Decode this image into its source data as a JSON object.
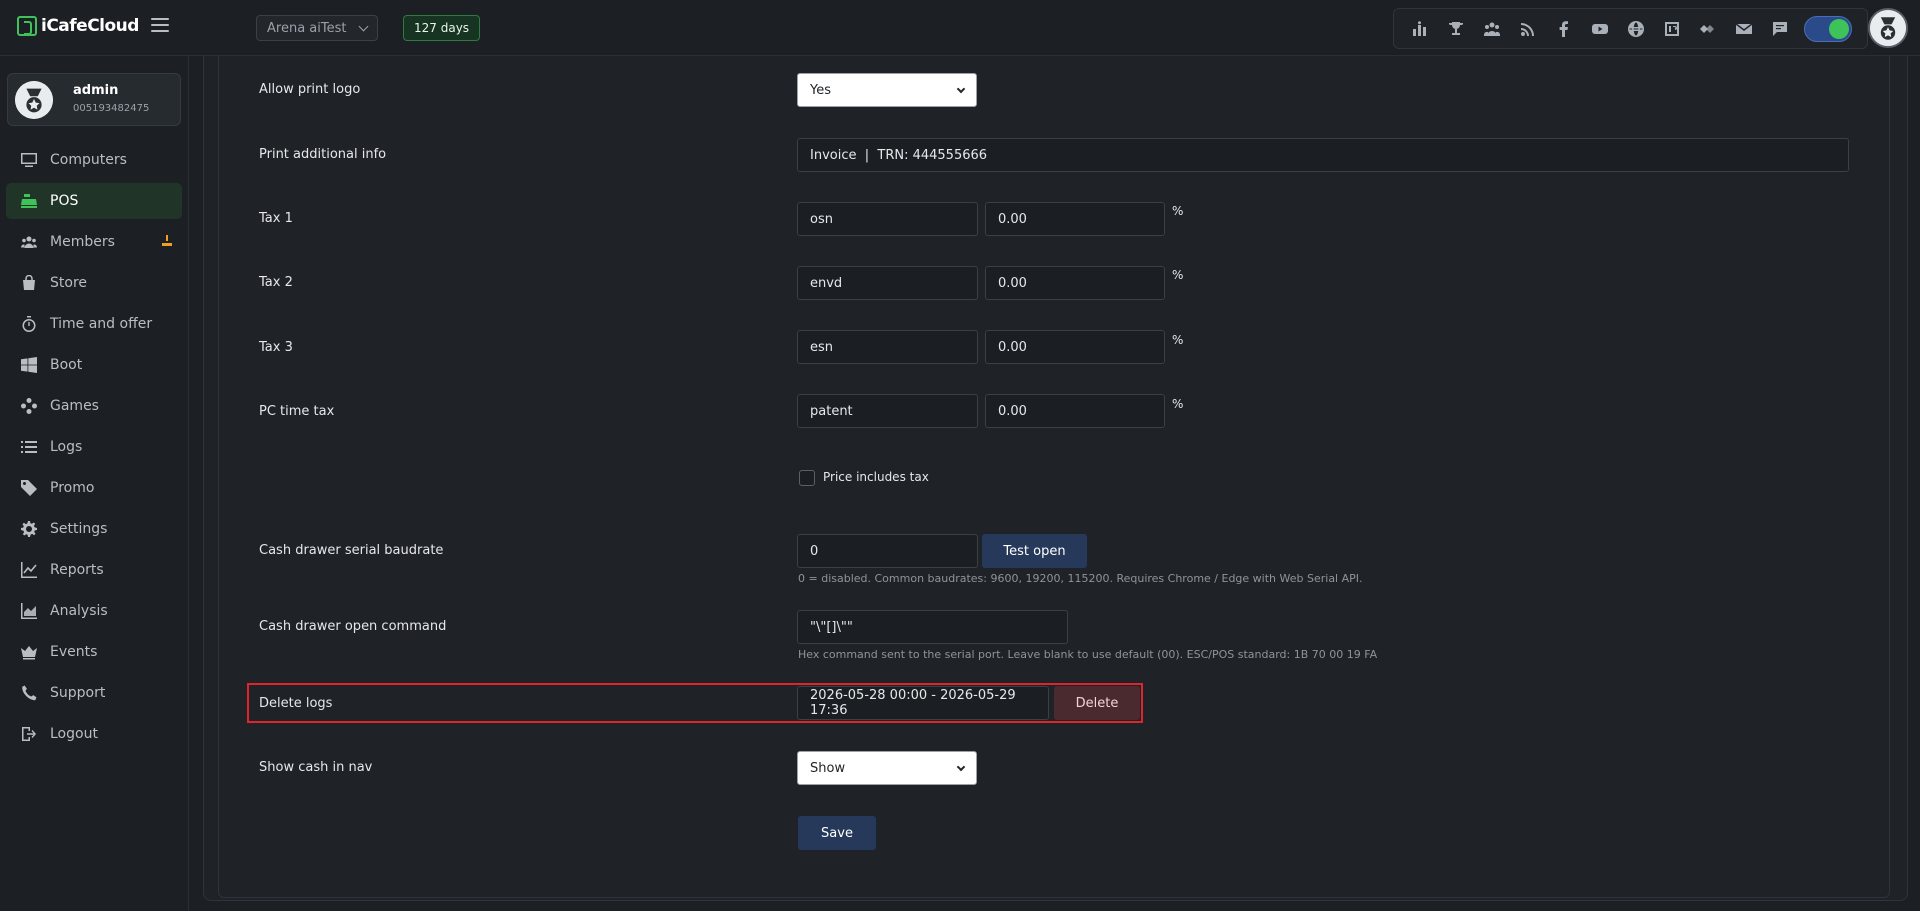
{
  "header": {
    "logo_text": "iCafeCloud",
    "cafe_name": "Arena aiTest",
    "days_badge": "127 days",
    "toolbar_icons": [
      "ranking-icon",
      "trophy-icon",
      "users-group-icon",
      "rss-icon",
      "facebook-icon",
      "youtube-icon",
      "globe-icon",
      "icafe-icon",
      "eye-icon",
      "mail-icon",
      "chat-icon"
    ]
  },
  "user": {
    "name": "admin",
    "id": "005193482475"
  },
  "sidebar": {
    "items": [
      {
        "label": "Computers",
        "icon": "monitor-icon"
      },
      {
        "label": "POS",
        "icon": "cash-register-icon"
      },
      {
        "label": "Members",
        "icon": "members-icon"
      },
      {
        "label": "Store",
        "icon": "bag-icon"
      },
      {
        "label": "Time and offer",
        "icon": "stopwatch-icon"
      },
      {
        "label": "Boot",
        "icon": "windows-icon"
      },
      {
        "label": "Games",
        "icon": "gamepad-icon"
      },
      {
        "label": "Logs",
        "icon": "list-icon"
      },
      {
        "label": "Promo",
        "icon": "tag-icon"
      },
      {
        "label": "Settings",
        "icon": "gear-icon"
      },
      {
        "label": "Reports",
        "icon": "chart-line-icon"
      },
      {
        "label": "Analysis",
        "icon": "chart-area-icon"
      },
      {
        "label": "Events",
        "icon": "crown-icon"
      },
      {
        "label": "Support",
        "icon": "phone-icon"
      },
      {
        "label": "Logout",
        "icon": "logout-icon"
      }
    ],
    "active": "POS",
    "accent": "#3ec35a"
  },
  "form": {
    "allow_print_logo": {
      "label": "Allow print logo",
      "value": "Yes"
    },
    "print_additional_info": {
      "label": "Print additional info",
      "value": "Invoice  |  TRN: 444555666"
    },
    "tax1": {
      "label": "Tax 1",
      "name": "osn",
      "rate": "0.00",
      "unit": "%"
    },
    "tax2": {
      "label": "Tax 2",
      "name": "envd",
      "rate": "0.00",
      "unit": "%"
    },
    "tax3": {
      "label": "Tax 3",
      "name": "esn",
      "rate": "0.00",
      "unit": "%"
    },
    "pc_time_tax": {
      "label": "PC time tax",
      "name": "patent",
      "rate": "0.00",
      "unit": "%"
    },
    "price_includes_tax": {
      "label": "Price includes tax",
      "checked": false
    },
    "cash_drawer_baudrate": {
      "label": "Cash drawer serial baudrate",
      "value": "0",
      "button": "Test open",
      "hint": "0 = disabled. Common baudrates: 9600, 19200, 115200. Requires Chrome / Edge with Web Serial API."
    },
    "cash_drawer_command": {
      "label": "Cash drawer open command",
      "value": "\"\\\"[]\\\"\"",
      "hint": "Hex command sent to the serial port. Leave blank to use default (00). ESC/POS standard: 1B 70 00 19 FA"
    },
    "delete_logs": {
      "label": "Delete logs",
      "range": "2026-05-28 00:00 - 2026-05-29 17:36",
      "button": "Delete"
    },
    "show_cash_in_nav": {
      "label": "Show cash in nav",
      "value": "Show"
    },
    "save_button": "Save"
  }
}
